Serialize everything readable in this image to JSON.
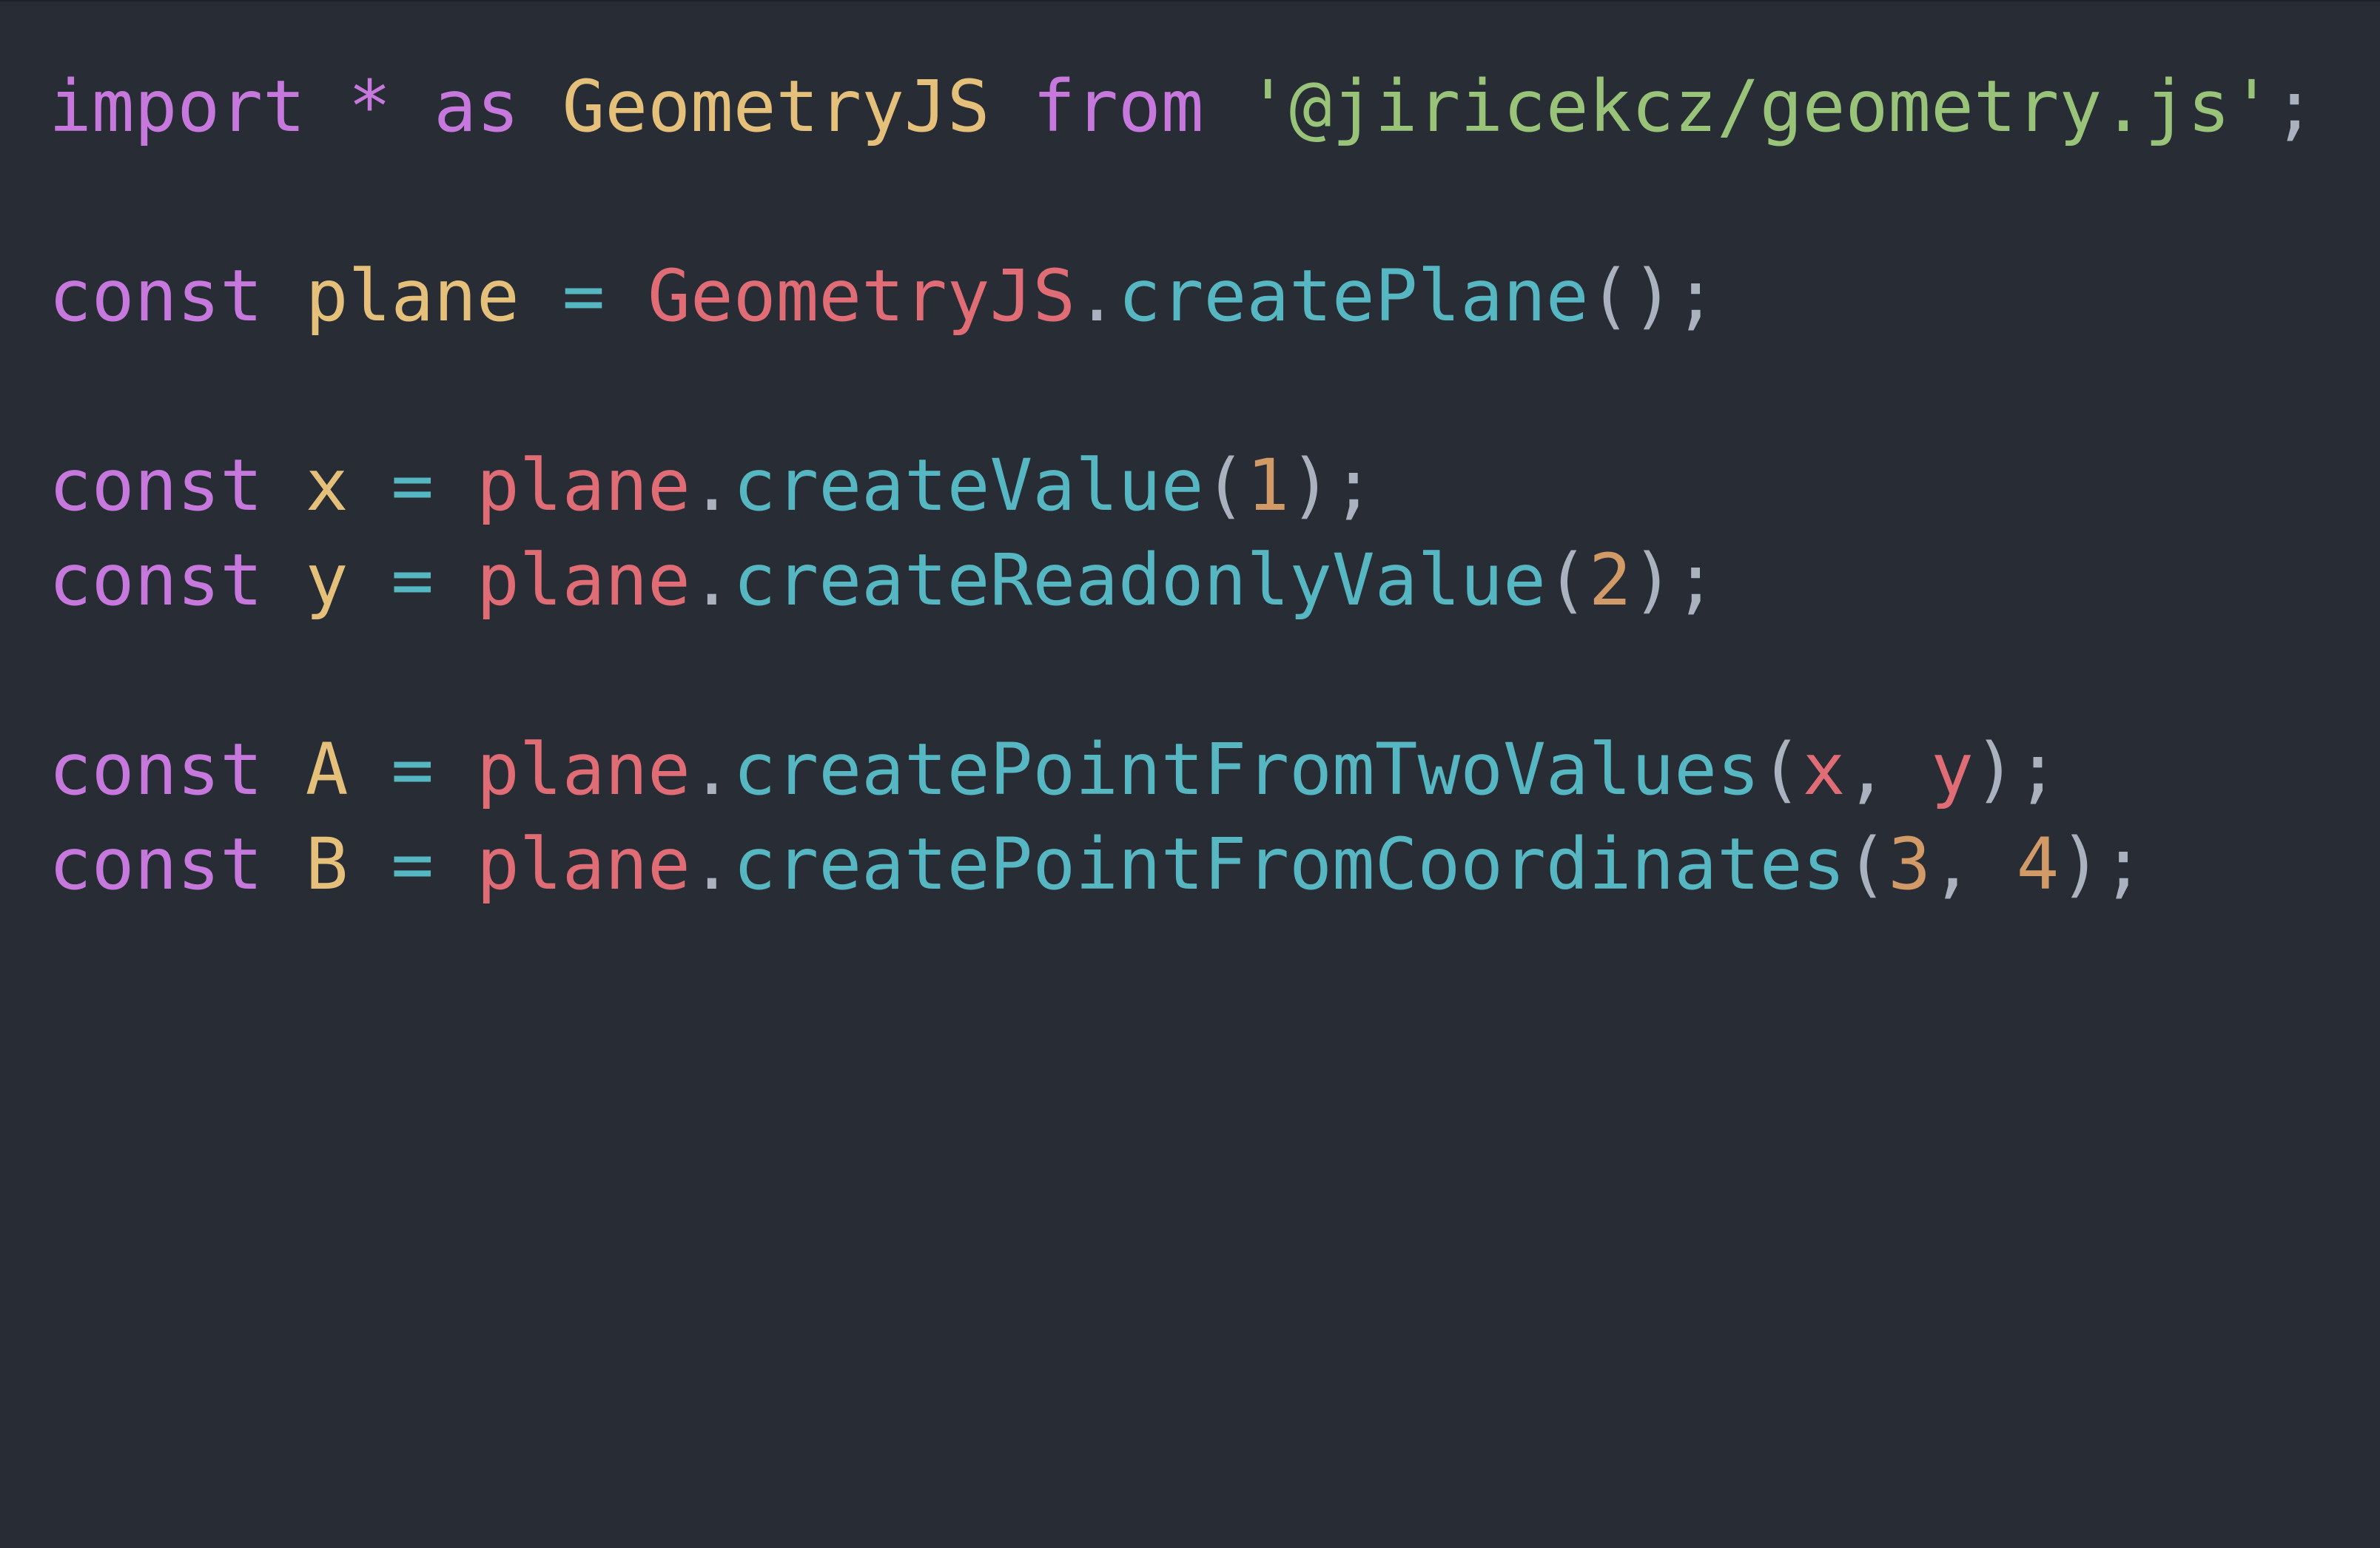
{
  "editor": {
    "background": "#282c34",
    "theme_colors": {
      "keyword": "#c678dd",
      "class": "#e5c07b",
      "string": "#98c379",
      "variable": "#e06c75",
      "function": "#56b6c2",
      "number": "#d19a66",
      "punctuation": "#abb2bf"
    },
    "lines": [
      {
        "tokens": [
          {
            "text": "import",
            "kind": "kw"
          },
          {
            "text": " ",
            "kind": "pun"
          },
          {
            "text": "*",
            "kind": "kw"
          },
          {
            "text": " ",
            "kind": "pun"
          },
          {
            "text": "as",
            "kind": "kw"
          },
          {
            "text": " ",
            "kind": "pun"
          },
          {
            "text": "GeometryJS",
            "kind": "cls"
          },
          {
            "text": " ",
            "kind": "pun"
          },
          {
            "text": "from",
            "kind": "kw"
          },
          {
            "text": " ",
            "kind": "pun"
          },
          {
            "text": "'@jiricekcz/geometry.js'",
            "kind": "str"
          },
          {
            "text": ";",
            "kind": "pun"
          }
        ]
      },
      {
        "tokens": []
      },
      {
        "tokens": [
          {
            "text": "const",
            "kind": "kw"
          },
          {
            "text": " ",
            "kind": "pun"
          },
          {
            "text": "plane",
            "kind": "def"
          },
          {
            "text": " ",
            "kind": "pun"
          },
          {
            "text": "=",
            "kind": "fn"
          },
          {
            "text": " ",
            "kind": "pun"
          },
          {
            "text": "GeometryJS",
            "kind": "var"
          },
          {
            "text": ".",
            "kind": "pun"
          },
          {
            "text": "createPlane",
            "kind": "fn"
          },
          {
            "text": "();",
            "kind": "pun"
          }
        ]
      },
      {
        "tokens": []
      },
      {
        "tokens": [
          {
            "text": "const",
            "kind": "kw"
          },
          {
            "text": " ",
            "kind": "pun"
          },
          {
            "text": "x",
            "kind": "def"
          },
          {
            "text": " ",
            "kind": "pun"
          },
          {
            "text": "=",
            "kind": "fn"
          },
          {
            "text": " ",
            "kind": "pun"
          },
          {
            "text": "plane",
            "kind": "var"
          },
          {
            "text": ".",
            "kind": "pun"
          },
          {
            "text": "createValue",
            "kind": "fn"
          },
          {
            "text": "(",
            "kind": "pun"
          },
          {
            "text": "1",
            "kind": "num"
          },
          {
            "text": ");",
            "kind": "pun"
          }
        ]
      },
      {
        "tokens": [
          {
            "text": "const",
            "kind": "kw"
          },
          {
            "text": " ",
            "kind": "pun"
          },
          {
            "text": "y",
            "kind": "def"
          },
          {
            "text": " ",
            "kind": "pun"
          },
          {
            "text": "=",
            "kind": "fn"
          },
          {
            "text": " ",
            "kind": "pun"
          },
          {
            "text": "plane",
            "kind": "var"
          },
          {
            "text": ".",
            "kind": "pun"
          },
          {
            "text": "createReadonlyValue",
            "kind": "fn"
          },
          {
            "text": "(",
            "kind": "pun"
          },
          {
            "text": "2",
            "kind": "num"
          },
          {
            "text": ");",
            "kind": "pun"
          }
        ]
      },
      {
        "tokens": []
      },
      {
        "tokens": [
          {
            "text": "const",
            "kind": "kw"
          },
          {
            "text": " ",
            "kind": "pun"
          },
          {
            "text": "A",
            "kind": "def"
          },
          {
            "text": " ",
            "kind": "pun"
          },
          {
            "text": "=",
            "kind": "fn"
          },
          {
            "text": " ",
            "kind": "pun"
          },
          {
            "text": "plane",
            "kind": "var"
          },
          {
            "text": ".",
            "kind": "pun"
          },
          {
            "text": "createPointFromTwoValues",
            "kind": "fn"
          },
          {
            "text": "(",
            "kind": "pun"
          },
          {
            "text": "x",
            "kind": "var"
          },
          {
            "text": ", ",
            "kind": "pun"
          },
          {
            "text": "y",
            "kind": "var"
          },
          {
            "text": ");",
            "kind": "pun"
          }
        ]
      },
      {
        "tokens": [
          {
            "text": "const",
            "kind": "kw"
          },
          {
            "text": " ",
            "kind": "pun"
          },
          {
            "text": "B",
            "kind": "def"
          },
          {
            "text": " ",
            "kind": "pun"
          },
          {
            "text": "=",
            "kind": "fn"
          },
          {
            "text": " ",
            "kind": "pun"
          },
          {
            "text": "plane",
            "kind": "var"
          },
          {
            "text": ".",
            "kind": "pun"
          },
          {
            "text": "createPointFromCoordinates",
            "kind": "fn"
          },
          {
            "text": "(",
            "kind": "pun"
          },
          {
            "text": "3",
            "kind": "num"
          },
          {
            "text": ", ",
            "kind": "pun"
          },
          {
            "text": "4",
            "kind": "num"
          },
          {
            "text": ");",
            "kind": "pun"
          }
        ]
      }
    ]
  }
}
